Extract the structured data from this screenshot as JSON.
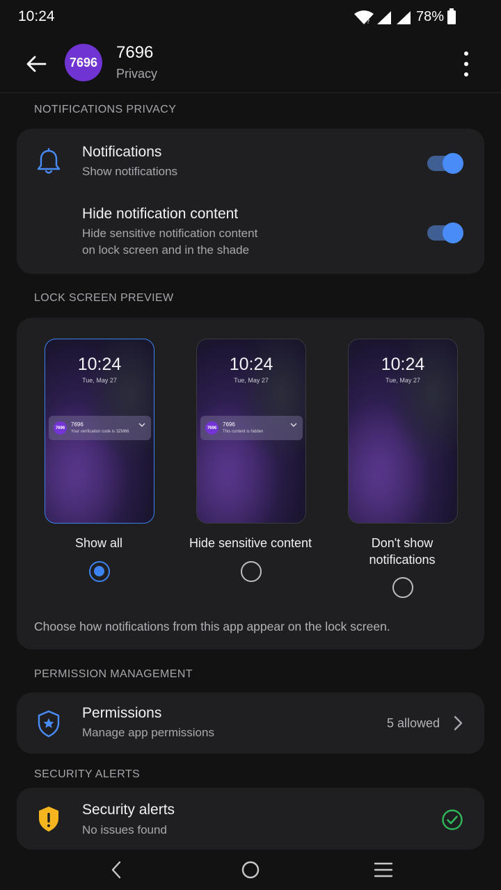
{
  "status": {
    "time": "10:24",
    "battery": "78%"
  },
  "header": {
    "avatar_text": "7696",
    "title": "7696",
    "subtitle": "Privacy"
  },
  "notifications_privacy": {
    "header": "NOTIFICATIONS PRIVACY",
    "notifications": {
      "title": "Notifications",
      "subtitle": "Show notifications",
      "enabled": true
    },
    "hide_content": {
      "title": "Hide notification content",
      "subtitle_line1": "Hide sensitive notification content",
      "subtitle_line2": "on lock screen and in the shade",
      "enabled": true
    }
  },
  "lock_screen_preview": {
    "header": "LOCK SCREEN PREVIEW",
    "phone_time": "10:24",
    "phone_date": "Tue, May 27",
    "options": [
      {
        "label": "Show all",
        "notif_title": "7696",
        "notif_body": "Your verification code is 3ZM66",
        "notif_avatar": "7696",
        "selected": true
      },
      {
        "label": "Hide sensitive content",
        "notif_title": "7696",
        "notif_body": "This content is hidden",
        "notif_avatar": "7696",
        "selected": false
      },
      {
        "label_line1": "Don't show",
        "label_line2": "notifications",
        "selected": false
      }
    ],
    "footer": "Choose how notifications from this app appear on the lock screen."
  },
  "permission_management": {
    "header": "PERMISSION MANAGEMENT",
    "title": "Permissions",
    "subtitle": "Manage app permissions",
    "value": "5 allowed"
  },
  "security_alerts": {
    "header": "SECURITY ALERTS",
    "title": "Security alerts",
    "subtitle": "No issues found"
  },
  "colors": {
    "accent": "#3c83f0",
    "avatar": "#6f34d1",
    "warning": "#f5b51f",
    "success": "#2fb85a",
    "card": "#1f1f21"
  },
  "icons": [
    "back-arrow-icon",
    "more-vert-icon",
    "bell-icon",
    "shield-star-icon",
    "chevron-right-icon",
    "shield-warning-icon",
    "check-circle-icon"
  ]
}
